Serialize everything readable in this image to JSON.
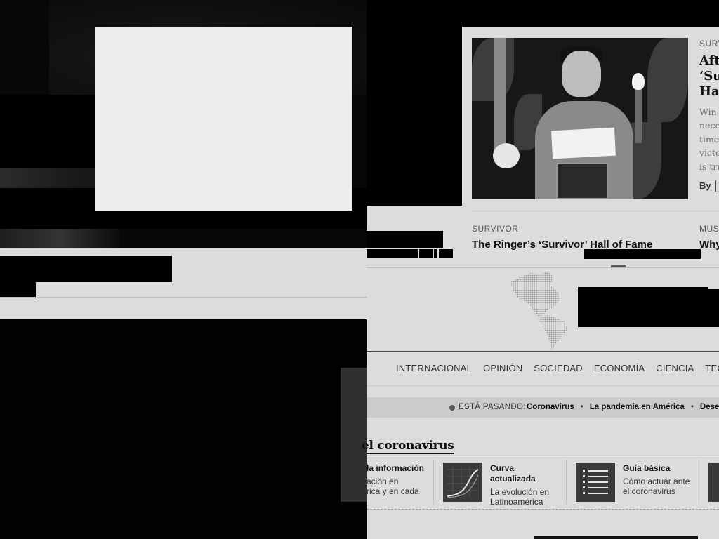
{
  "card": {
    "kicker": "SURV",
    "title": "Aft\n‘Su\nHas",
    "dek": "Win\nnece\ntime\nvicto\nis tru",
    "byline": "By"
  },
  "related": [
    {
      "kicker": "SURVIVOR",
      "title": "The Ringer’s ‘Survivor’ Hall of Fame"
    },
    {
      "kicker": "MUS",
      "title": "Why"
    }
  ],
  "nav": {
    "items": [
      "INTERNACIONAL",
      "OPINIÓN",
      "SOCIEDAD",
      "ECONOMÍA",
      "CIENCIA",
      "TECNOLO"
    ]
  },
  "trending": {
    "label": "ESTÁ PASANDO:",
    "links": [
      "Coronavirus",
      "La pandemia en América",
      "Desem"
    ]
  },
  "section": {
    "title": "el coronavirus"
  },
  "tiles": [
    {
      "title": "la información",
      "desc": "ación en\nrica y en cada"
    },
    {
      "title": "Curva\nactualizada",
      "desc": "La evolución en\nLatinoamérica",
      "icon": "chart-curve-icon"
    },
    {
      "title": "Guía básica",
      "desc": "Cómo actuar ante\nel coronavirus",
      "icon": "checklist-icon"
    }
  ],
  "colors": {
    "page_bg": "#dcdcdc",
    "text": "#111111",
    "muted": "#555555"
  }
}
